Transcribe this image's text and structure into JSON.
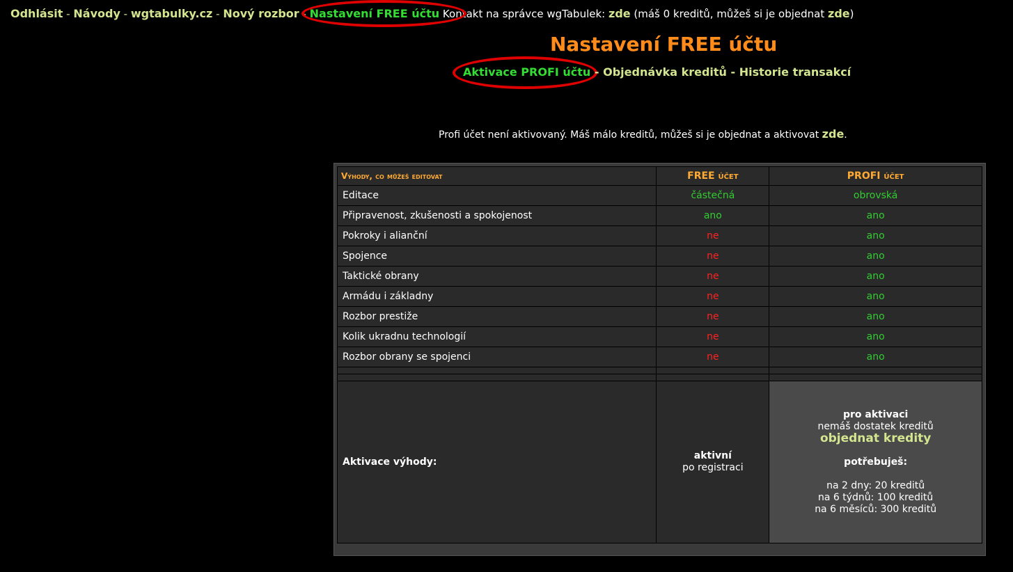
{
  "topnav": {
    "logout": "Odhlásit",
    "guides": "Návody",
    "site": "wgtabulky.cz",
    "new_analysis": "Nový rozbor",
    "settings_free": "Nastavení FREE účtu",
    "contact_text": "Kontakt na správce wgTabulek:",
    "contact_link": "zde",
    "credits_text": "(máš 0 kreditů, můžeš si je objednat",
    "credits_link": "zde",
    "credits_close": ")",
    "separator": "-"
  },
  "page": {
    "title": "Nastavení FREE účtu"
  },
  "subnav": {
    "activate_profi": "Aktivace PROFI účtu",
    "order_credits": "Objednávka kreditů",
    "history": "Historie transakcí",
    "separator": "-"
  },
  "notice": {
    "text": "Profi účet není aktivovaný. Máš málo kreditů, můžeš si je objednat a aktivovat",
    "link": "zde",
    "end": "."
  },
  "table": {
    "headers": {
      "benefits": "Výhody, co můžeš editovat",
      "free": "FREE účet",
      "profi": "PROFI účet"
    },
    "rows": [
      {
        "label": "Editace",
        "free": "částečná",
        "profi": "obrovská"
      },
      {
        "label": "Připravenost, zkušenosti a spokojenost",
        "free": "ano",
        "profi": "ano"
      },
      {
        "label": "Pokroky i alianční",
        "free": "ne",
        "profi": "ano"
      },
      {
        "label": "Spojence",
        "free": "ne",
        "profi": "ano"
      },
      {
        "label": "Taktické obrany",
        "free": "ne",
        "profi": "ano"
      },
      {
        "label": "Armádu i základny",
        "free": "ne",
        "profi": "ano"
      },
      {
        "label": "Rozbor prestiže",
        "free": "ne",
        "profi": "ano"
      },
      {
        "label": "Kolik ukradnu technologií",
        "free": "ne",
        "profi": "ano"
      },
      {
        "label": "Rozbor obrany se spojenci",
        "free": "ne",
        "profi": "ano"
      }
    ],
    "activation": {
      "label": "Aktivace výhody:",
      "free_status": "aktivní",
      "free_note": "po registraci",
      "profi_heading": "pro aktivaci",
      "profi_insufficient": "nemáš dostatek kreditů",
      "profi_order_link": "objednat kredity",
      "profi_need": "potřebuješ:",
      "prices": [
        "na 2 dny: 20 kreditů",
        "na 6 týdnů: 100 kreditů",
        "na 6 měsíců: 300 kreditů"
      ]
    }
  },
  "colors": {
    "accent_orange": "#ff8c1a",
    "link_yellowgreen": "#d3e58f",
    "active_green": "#33dd33",
    "yes_green": "#33cc33",
    "no_red": "#ff2222",
    "annotation_red": "#e00000"
  }
}
